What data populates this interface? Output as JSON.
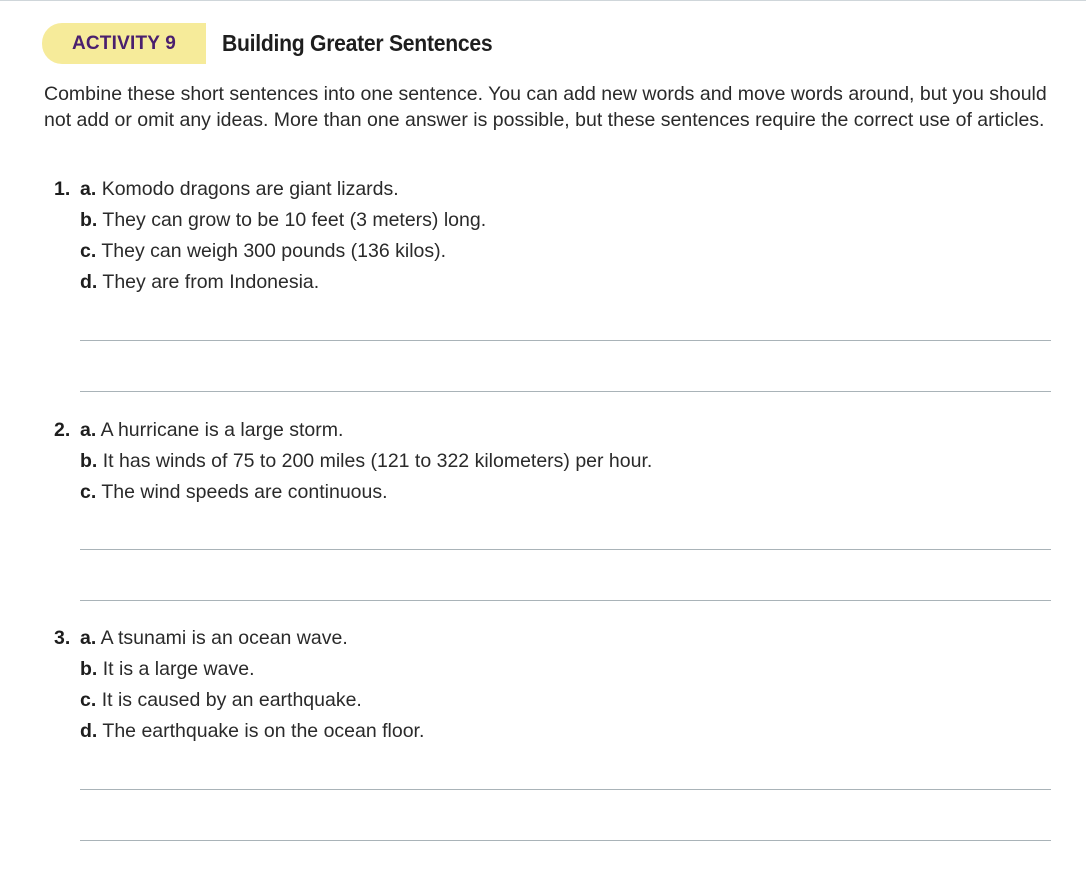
{
  "header": {
    "activity_label": "ACTIVITY 9",
    "title": "Building Greater Sentences"
  },
  "instructions": "Combine these short sentences into one sentence. You can add new words and move words around, but you should not add or omit any ideas. More than one answer is possible, but these sentences require the correct use of articles.",
  "items": [
    {
      "number": "1.",
      "sentences": [
        {
          "letter": "a.",
          "text": "Komodo dragons are giant lizards."
        },
        {
          "letter": "b.",
          "text": "They can grow to be 10 feet (3 meters) long."
        },
        {
          "letter": "c.",
          "text": "They can weigh 300 pounds (136 kilos)."
        },
        {
          "letter": "d.",
          "text": "They are from Indonesia."
        }
      ]
    },
    {
      "number": "2.",
      "sentences": [
        {
          "letter": "a.",
          "text": "A hurricane is a large storm."
        },
        {
          "letter": "b.",
          "text": "It has winds of 75 to 200 miles (121 to 322 kilometers) per hour."
        },
        {
          "letter": "c.",
          "text": "The wind speeds are continuous."
        }
      ]
    },
    {
      "number": "3.",
      "sentences": [
        {
          "letter": "a.",
          "text": "A tsunami is an ocean wave."
        },
        {
          "letter": "b.",
          "text": "It is a large wave."
        },
        {
          "letter": "c.",
          "text": "It is caused by an earthquake."
        },
        {
          "letter": "d.",
          "text": "The earthquake is on the ocean floor."
        }
      ]
    }
  ]
}
